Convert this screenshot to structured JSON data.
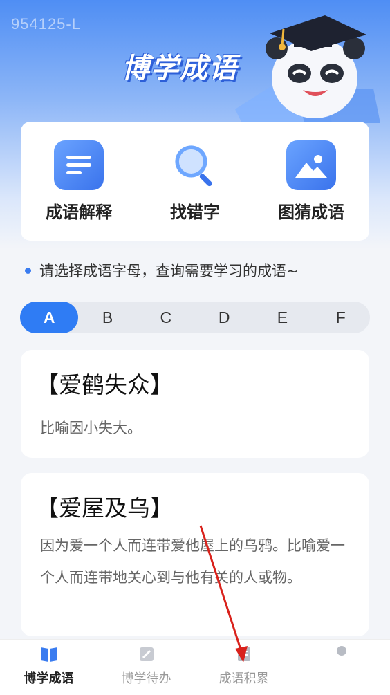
{
  "watermark": "954125-L",
  "app_title": "博学成语",
  "features": [
    {
      "label": "成语解释",
      "icon": "document-lines-icon"
    },
    {
      "label": "找错字",
      "icon": "magnifier-icon"
    },
    {
      "label": "图猜成语",
      "icon": "picture-icon"
    }
  ],
  "hint": "请选择成语字母，查询需要学习的成语~",
  "letters": [
    "A",
    "B",
    "C",
    "D",
    "E",
    "F"
  ],
  "selected_letter": "A",
  "idioms": [
    {
      "title": "【爱鹤失众】",
      "desc": "比喻因小失大。"
    },
    {
      "title": "【爱屋及乌】",
      "desc": "因为爱一个人而连带爱他屋上的乌鸦。比喻爱一个人而连带地关心到与他有关的人或物。"
    }
  ],
  "tabs": [
    {
      "label": "博学成语",
      "icon": "book-icon"
    },
    {
      "label": "博学待办",
      "icon": "todo-icon"
    },
    {
      "label": "成语积累",
      "icon": "notebook-icon"
    },
    {
      "label": "",
      "icon": "profile-icon"
    }
  ],
  "colors": {
    "accent": "#2f7cf4",
    "annotation_arrow": "#d9221c"
  }
}
